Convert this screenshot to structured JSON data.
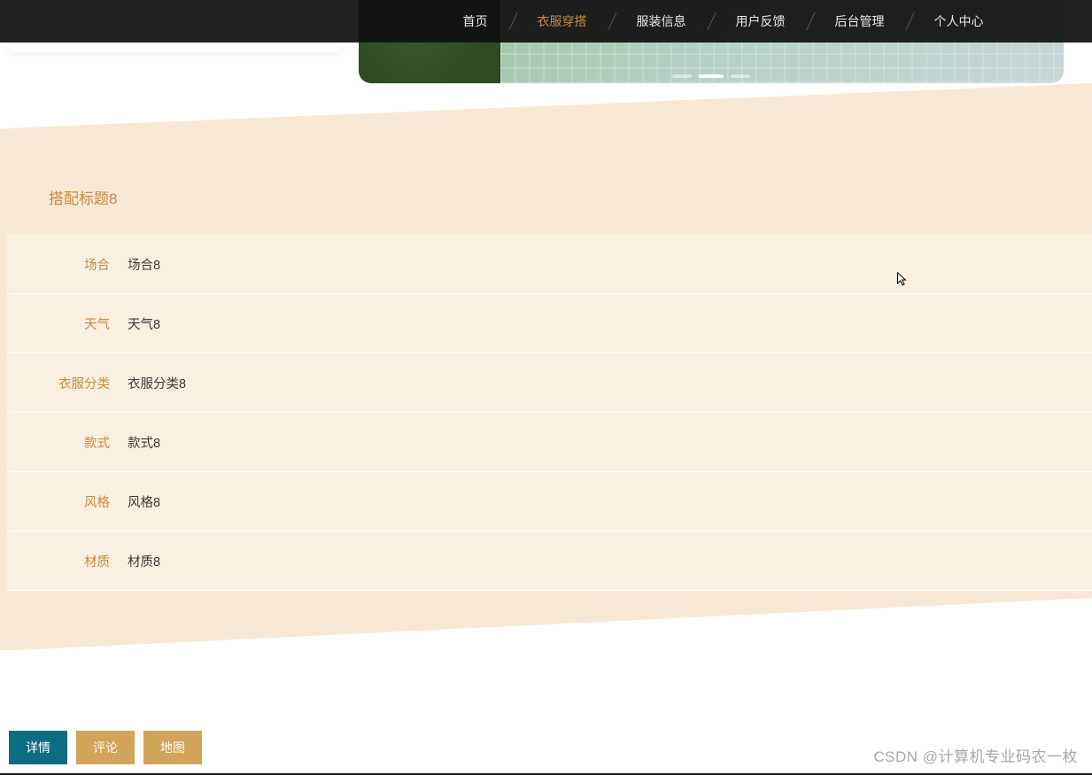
{
  "nav": {
    "items": [
      {
        "label": "首页",
        "active": false
      },
      {
        "label": "衣服穿搭",
        "active": true
      },
      {
        "label": "服装信息",
        "active": false
      },
      {
        "label": "用户反馈",
        "active": false
      },
      {
        "label": "后台管理",
        "active": false
      },
      {
        "label": "个人中心",
        "active": false
      }
    ]
  },
  "page": {
    "title": "搭配标题8"
  },
  "details": [
    {
      "label": "场合",
      "value": "场合8"
    },
    {
      "label": "天气",
      "value": "天气8"
    },
    {
      "label": "衣服分类",
      "value": "衣服分类8"
    },
    {
      "label": "款式",
      "value": "款式8"
    },
    {
      "label": "风格",
      "value": "风格8"
    },
    {
      "label": "材质",
      "value": "材质8"
    }
  ],
  "tabs": [
    {
      "label": "详情",
      "kind": "primary"
    },
    {
      "label": "评论",
      "kind": "secondary"
    },
    {
      "label": "地图",
      "kind": "secondary"
    }
  ],
  "watermark": "CSDN @计算机专业码农一枚",
  "colors": {
    "accent": "#cc8a3a",
    "beige": "#f6e8d4",
    "primary_tab": "#0c6d82",
    "secondary_tab": "#d2a45a"
  }
}
